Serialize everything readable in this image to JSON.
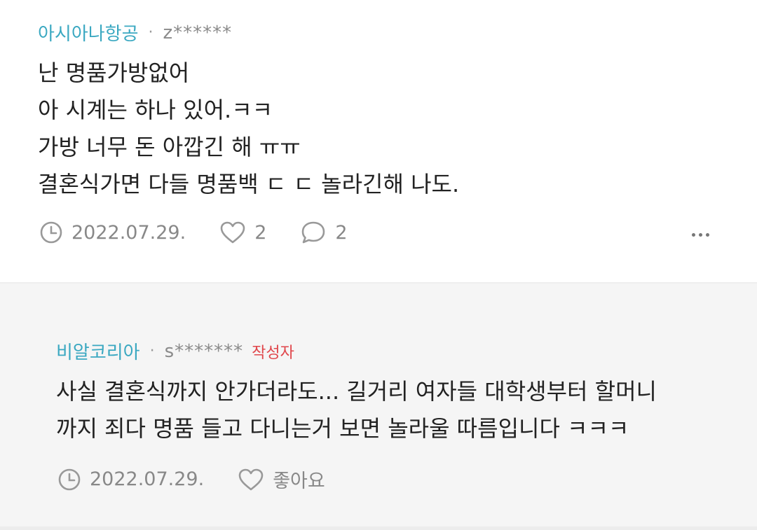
{
  "comment": {
    "nickname": "아시아나항공",
    "separator": "·",
    "masked_id": "z******",
    "lines": [
      "난 명품가방없어",
      "아 시계는 하나 있어.ㅋㅋ",
      "가방 너무 돈 아깝긴 해 ㅠㅠ",
      "결혼식가면 다들 명품백 ㄷ ㄷ 놀라긴해 나도."
    ],
    "date": "2022.07.29.",
    "like_count": "2",
    "reply_count": "2"
  },
  "reply": {
    "nickname": "비알코리아",
    "separator": "·",
    "masked_id": "s*******",
    "badge": "작성자",
    "lines": [
      "사실 결혼식까지 안가더라도... 길거리 여자들 대학생부터 할머니",
      "까지 죄다 명품 들고 다니는거 보면 놀라울 따름입니다 ㅋㅋㅋ"
    ],
    "date": "2022.07.29.",
    "like_label": "좋아요"
  },
  "colors": {
    "nickname": "#3aa8c1",
    "badge": "#e0464b",
    "meta": "#888888",
    "reply_bg": "#f5f5f5"
  },
  "icons": [
    "clock-icon",
    "heart-icon",
    "speech-bubble-icon",
    "more-dots-icon"
  ]
}
